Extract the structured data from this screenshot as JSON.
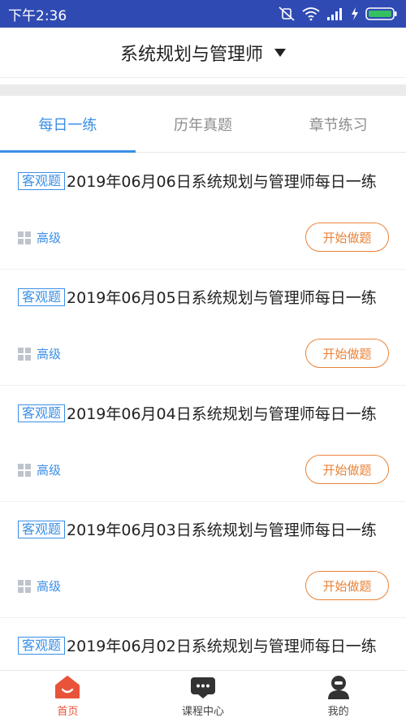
{
  "status_bar": {
    "time": "下午2:36"
  },
  "header": {
    "title": "系统规划与管理师",
    "dropdown_icon": "caret-down-icon"
  },
  "tabs": [
    {
      "label": "每日一练",
      "active": true
    },
    {
      "label": "历年真题",
      "active": false
    },
    {
      "label": "章节练习",
      "active": false
    }
  ],
  "exercises": [
    {
      "tag": "客观题",
      "title": "2019年06月06日系统规划与管理师每日一练",
      "level": "高级",
      "button": "开始做题"
    },
    {
      "tag": "客观题",
      "title": "2019年06月05日系统规划与管理师每日一练",
      "level": "高级",
      "button": "开始做题"
    },
    {
      "tag": "客观题",
      "title": "2019年06月04日系统规划与管理师每日一练",
      "level": "高级",
      "button": "开始做题"
    },
    {
      "tag": "客观题",
      "title": "2019年06月03日系统规划与管理师每日一练",
      "level": "高级",
      "button": "开始做题"
    },
    {
      "tag": "客观题",
      "title": "2019年06月02日系统规划与管理师每日一练",
      "level": "",
      "button": ""
    }
  ],
  "bottom_nav": [
    {
      "label": "首页",
      "icon": "home-icon",
      "active": true
    },
    {
      "label": "课程中心",
      "icon": "course-center-icon",
      "active": false
    },
    {
      "label": "我的",
      "icon": "profile-icon",
      "active": false
    }
  ],
  "colors": {
    "status_bar": "#2f4bb3",
    "accent_blue": "#3a8ee6",
    "accent_orange": "#e8833a",
    "nav_active": "#e8533a"
  }
}
